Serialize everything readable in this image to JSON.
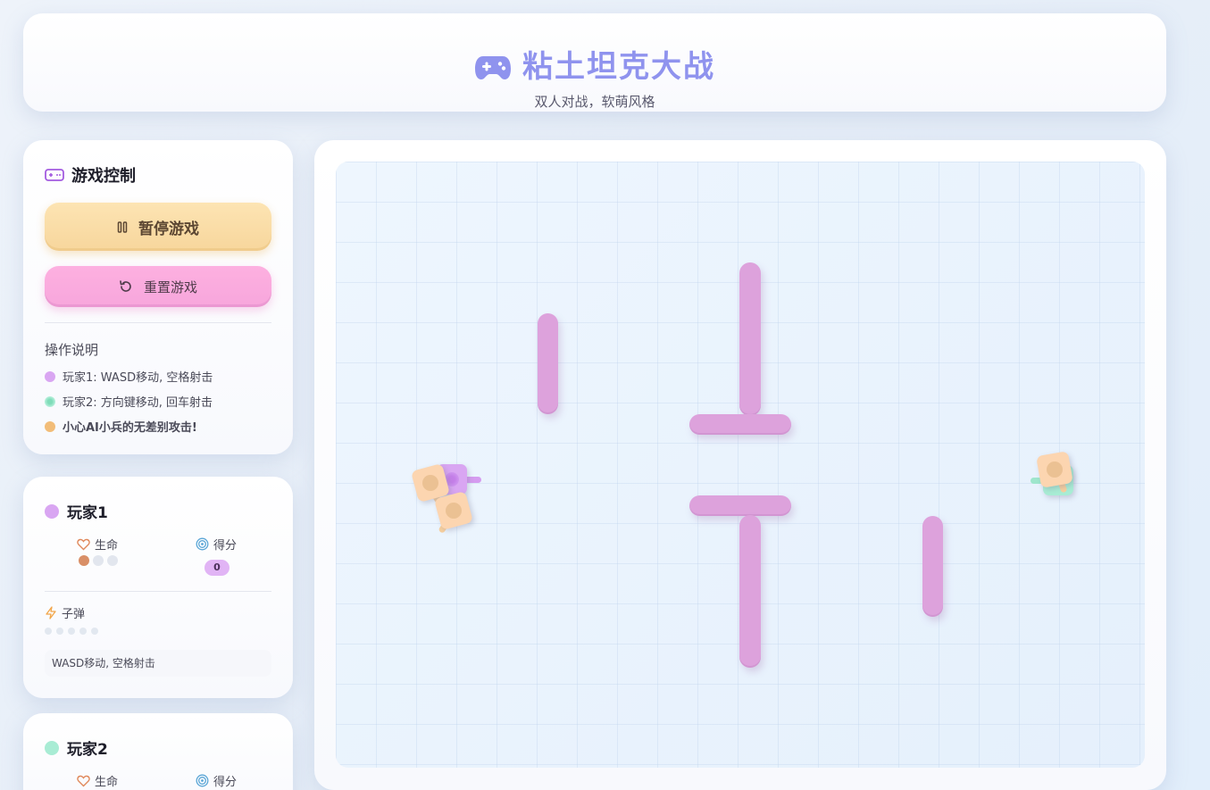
{
  "header": {
    "title": "粘土坦克大战",
    "subtitle": "双人对战，软萌风格",
    "logo_icon": "gamepad-icon"
  },
  "controls": {
    "title": "游戏控制",
    "title_icon": "gamepad-outline-icon",
    "pause_label": "暂停游戏",
    "pause_icon": "pause-icon",
    "reset_label": "重置游戏",
    "reset_icon": "rotate-ccw-icon",
    "help_title": "操作说明",
    "help_lines": [
      {
        "text": "玩家1: WASD移动, 空格射击",
        "color": "#d9a6f2"
      },
      {
        "text": "玩家2: 方向键移动, 回车射击",
        "color": "#a8ecd4"
      },
      {
        "text": "小心AI小兵的无差别攻击!",
        "color": "#f2bd78"
      }
    ]
  },
  "players": [
    {
      "name": "玩家1",
      "color": "#d9a6f2",
      "lives_label": "生命",
      "score_label": "得分",
      "score": "0",
      "lives_total": 3,
      "lives_remaining": 1,
      "ammo_label": "子弹",
      "ammo_total": 5,
      "ammo_remaining": 0,
      "control_hint": "WASD移动, 空格射击"
    },
    {
      "name": "玩家2",
      "color": "#a8ecd4",
      "lives_label": "生命",
      "score_label": "得分"
    }
  ],
  "colors": {
    "accent": "#8f93ee",
    "wall": "#dda2dc",
    "pause_button": "#fbdda7",
    "reset_button": "#f9aadd",
    "ai_tank": "#fcd5b0",
    "player1_tank": "#d9a6f2",
    "player2_tank": "#a8ecd4"
  }
}
